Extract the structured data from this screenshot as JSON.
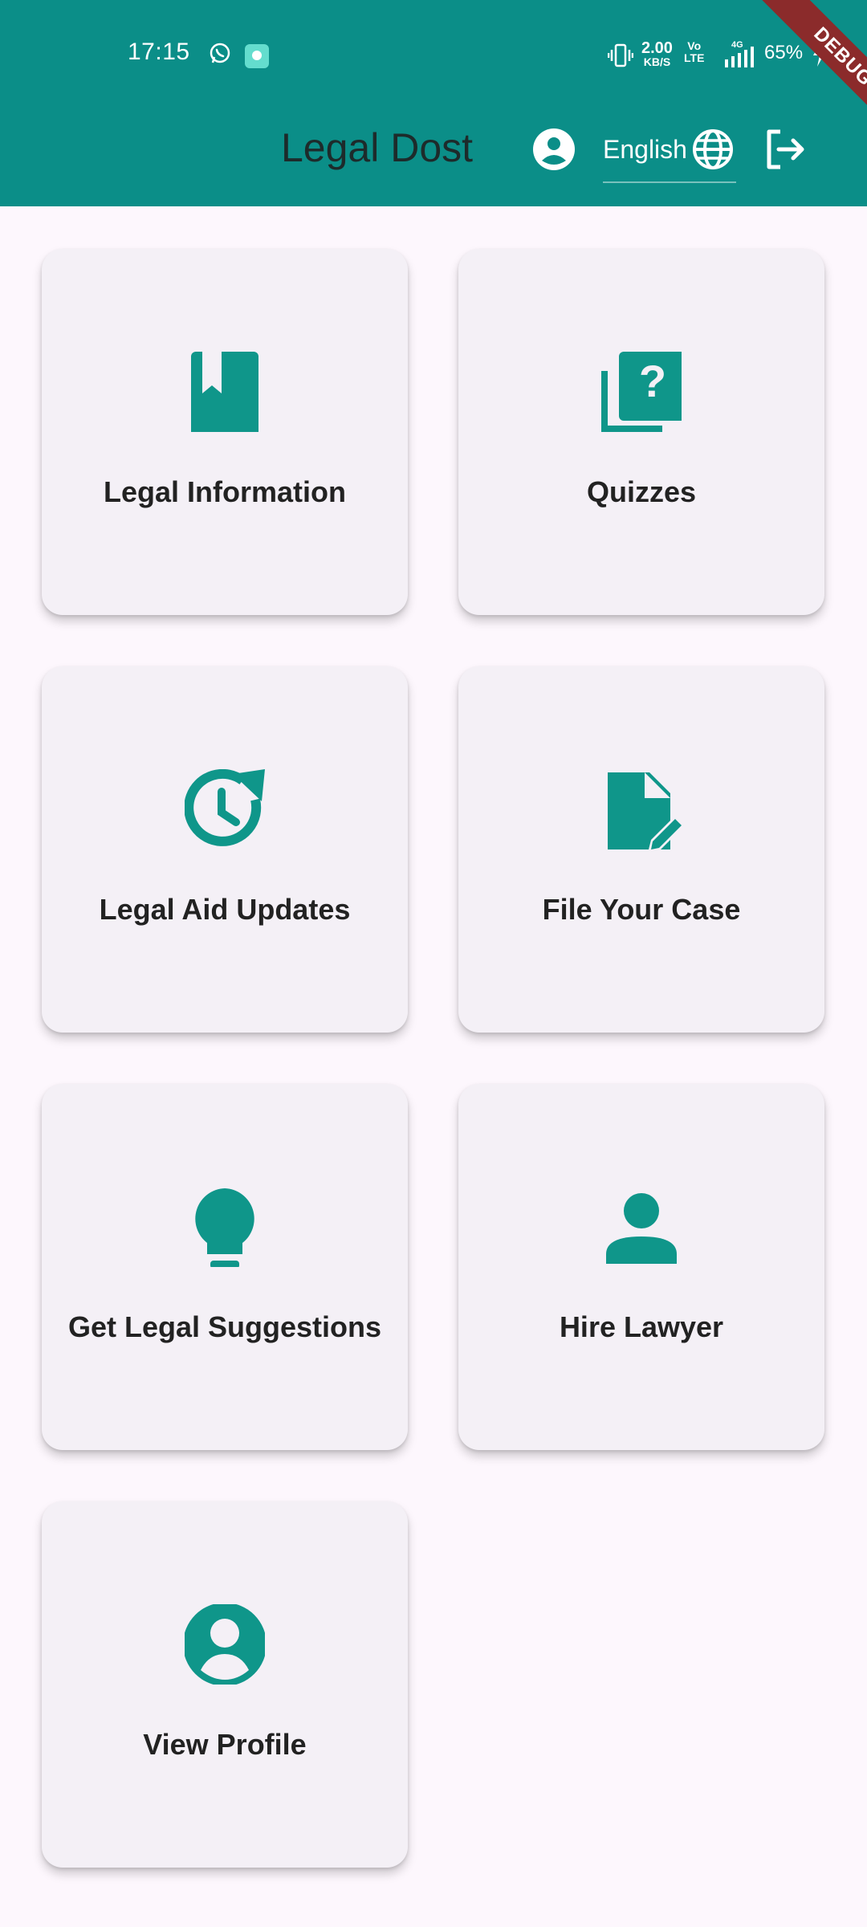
{
  "status_bar": {
    "time": "17:15",
    "net_speed_value": "2.00",
    "net_speed_unit": "KB/S",
    "volte_line1": "Vo",
    "volte_line2": "LTE",
    "network_type": "4G",
    "battery": "65%"
  },
  "debug_banner": "DEBUG",
  "header": {
    "title": "Legal Dost",
    "language_selected": "English"
  },
  "cards": [
    {
      "label": "Legal Information",
      "icon": "book-bookmark-icon"
    },
    {
      "label": "Quizzes",
      "icon": "quiz-icon"
    },
    {
      "label": "Legal Aid Updates",
      "icon": "update-clock-icon"
    },
    {
      "label": "File Your Case",
      "icon": "edit-document-icon"
    },
    {
      "label": "Get Legal Suggestions",
      "icon": "lightbulb-icon"
    },
    {
      "label": "Hire Lawyer",
      "icon": "person-icon"
    },
    {
      "label": "View Profile",
      "icon": "account-circle-icon"
    }
  ],
  "colors": {
    "primary": "#0b8e88",
    "icon_teal": "#0f968a",
    "card_bg": "#f4f0f6",
    "page_bg": "#fdf7fd",
    "debug_ribbon": "#8b2b2b"
  }
}
